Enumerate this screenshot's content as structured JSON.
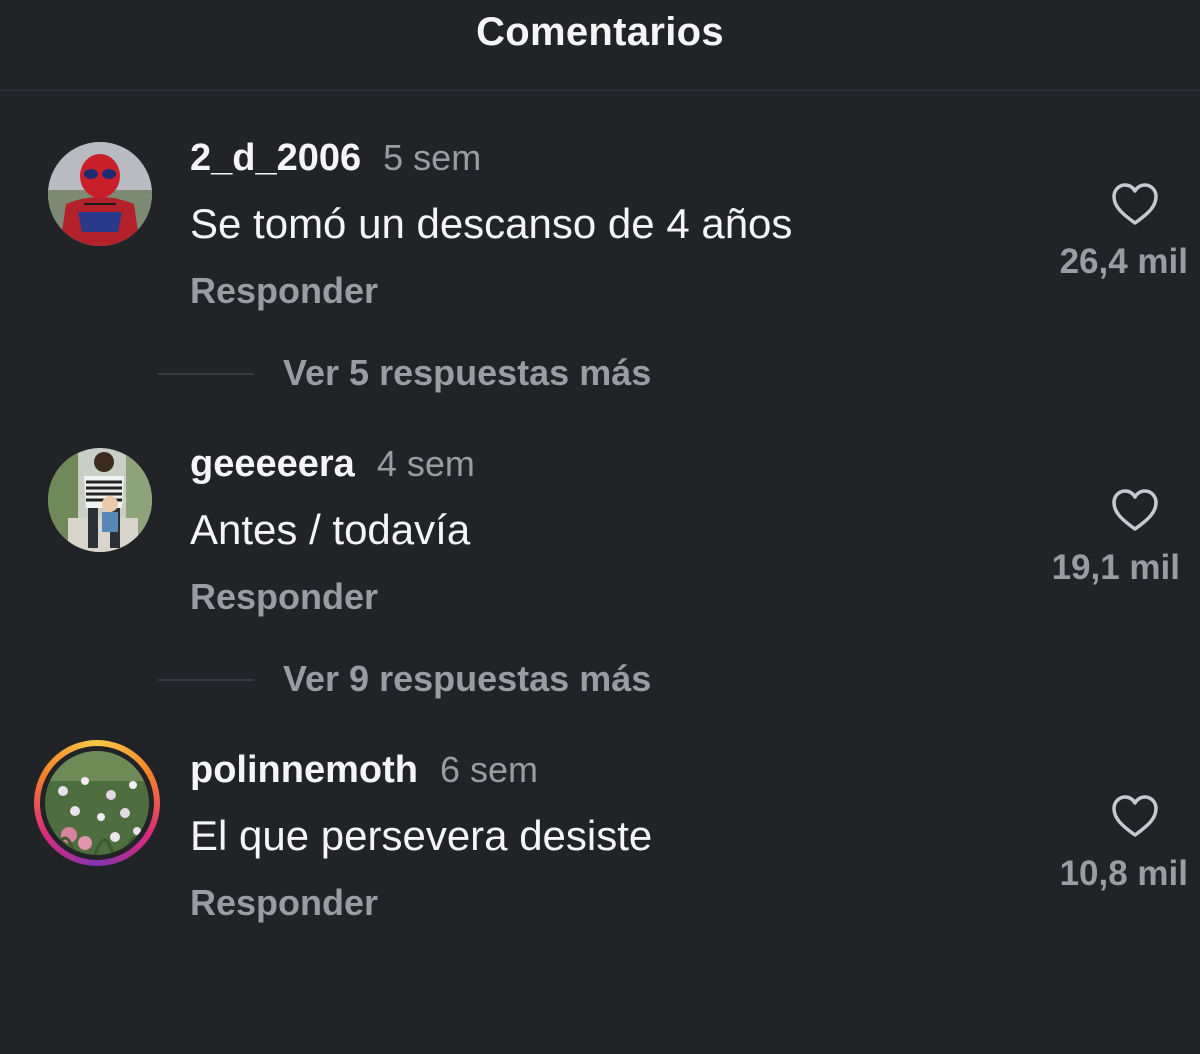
{
  "header": {
    "title": "Comentarios"
  },
  "comments": [
    {
      "username": "2_d_2006",
      "time": "5 sem",
      "text": "Se tomó un descanso de 4 años",
      "reply_label": "Responder",
      "likes": "26,4 mil",
      "more_replies": "Ver 5 respuestas más",
      "avatar_icon": "spiderman-avatar"
    },
    {
      "username": "geeeeera",
      "time": "4 sem",
      "text": "Antes / todavía",
      "reply_label": "Responder",
      "likes": "19,1 mil",
      "more_replies": "Ver 9 respuestas más",
      "avatar_icon": "father-child-avatar"
    },
    {
      "username": "polinnemoth",
      "time": "6 sem",
      "text": "El que persevera desiste",
      "reply_label": "Responder",
      "likes": "10,8 mil",
      "avatar_icon": "flowers-avatar",
      "has_story_ring": true
    }
  ],
  "colors": {
    "background": "#222327",
    "text_primary": "#f5f5f7",
    "text_secondary": "#9a9ca3",
    "story_ring": [
      "#f7c948",
      "#f58529",
      "#dd2a7b",
      "#8134af"
    ]
  },
  "icons": {
    "like": "heart-outline-icon"
  }
}
